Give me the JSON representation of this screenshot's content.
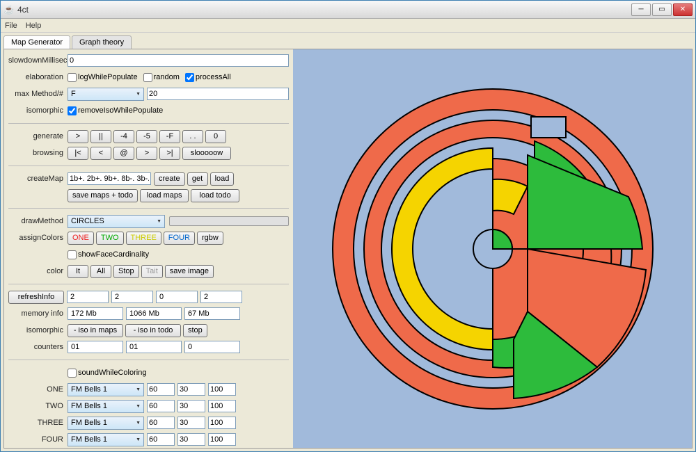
{
  "window": {
    "title": "4ct"
  },
  "menu": {
    "file": "File",
    "help": "Help"
  },
  "tabs": {
    "mapgen": "Map Generator",
    "graph": "Graph theory"
  },
  "panel": {
    "slowdownMillisec": {
      "label": "slowdownMillisec",
      "value": "0"
    },
    "elaboration": {
      "label": "elaboration",
      "logWhilePopulate": "logWhilePopulate",
      "random": "random",
      "processAll": "processAll"
    },
    "maxMethod": {
      "label": "max Method/#",
      "combo": "F",
      "num": "20"
    },
    "isomorphic": {
      "label": "isomorphic",
      "removeIsoWhilePopulate": "removeIsoWhilePopulate"
    },
    "generate": {
      "label": "generate",
      "btns": [
        ">",
        "||",
        "-4",
        "-5",
        "-F",
        ". .",
        "0"
      ]
    },
    "browsing": {
      "label": "browsing",
      "btns": [
        "|<",
        "<",
        "@",
        ">",
        ">|",
        "slooooow"
      ]
    },
    "createMap": {
      "label": "createMap",
      "value": "1b+. 2b+. 9b+. 8b-. 3b-.",
      "create": "create",
      "get": "get",
      "load": "load"
    },
    "mapActions": {
      "saveMaps": "save maps + todo",
      "loadMaps": "load maps",
      "loadTodo": "load todo"
    },
    "drawMethod": {
      "label": "drawMethod",
      "combo": "CIRCLES"
    },
    "assignColors": {
      "label": "assignColors",
      "one": "ONE",
      "two": "TWO",
      "three": "THREE",
      "four": "FOUR",
      "rgbw": "rgbw"
    },
    "showFaceCardinality": "showFaceCardinality",
    "colorRow": {
      "label": "color",
      "it": "It",
      "all": "All",
      "stop": "Stop",
      "tait": "Tait",
      "saveImage": "save image"
    },
    "refreshInfo": {
      "btn": "refreshInfo",
      "v1": "2",
      "v2": "2",
      "v3": "0",
      "v4": "2"
    },
    "memoryInfo": {
      "label": "memory info",
      "v1": "172 Mb",
      "v2": "1066 Mb",
      "v3": "67 Mb"
    },
    "isomorphic2": {
      "label": "isomorphic",
      "isoMaps": "- iso in maps",
      "isoTodo": "- iso in todo",
      "stop": "stop"
    },
    "counters": {
      "label": "counters",
      "v1": "01",
      "v2": "01",
      "v3": "0"
    },
    "soundWhileColoring": "soundWhileColoring",
    "soundRows": [
      {
        "label": "ONE",
        "preset": "FM Bells 1",
        "a": "60",
        "b": "30",
        "c": "100"
      },
      {
        "label": "TWO",
        "preset": "FM Bells 1",
        "a": "60",
        "b": "30",
        "c": "100"
      },
      {
        "label": "THREE",
        "preset": "FM Bells 1",
        "a": "60",
        "b": "30",
        "c": "100"
      },
      {
        "label": "FOUR",
        "preset": "FM Bells 1",
        "a": "60",
        "b": "30",
        "c": "100"
      }
    ]
  }
}
